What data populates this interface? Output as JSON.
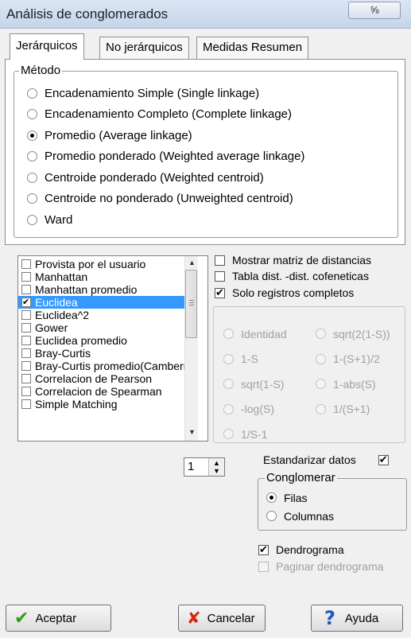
{
  "window": {
    "title": "Análisis de conglomerados",
    "close_glyph": "⅝"
  },
  "tabs": [
    "Jerárquicos",
    "No jerárquicos",
    "Medidas Resumen"
  ],
  "metodo": {
    "legend": "Método",
    "options": [
      "Encadenamiento Simple (Single linkage)",
      "Encadenamiento Completo (Complete linkage)",
      "Promedio (Average linkage)",
      "Promedio ponderado (Weighted average linkage)",
      "Centroide ponderado (Weighted centroid)",
      "Centroide no ponderado (Unweighted centroid)",
      "Ward"
    ],
    "selected_index": 2
  },
  "distance_list": {
    "items": [
      {
        "label": "Provista por el usuario",
        "checked": false
      },
      {
        "label": "Manhattan",
        "checked": false
      },
      {
        "label": "Manhattan promedio",
        "checked": false
      },
      {
        "label": "Euclidea",
        "checked": true
      },
      {
        "label": "Euclidea^2",
        "checked": false
      },
      {
        "label": "Gower",
        "checked": false
      },
      {
        "label": "Euclidea promedio",
        "checked": false
      },
      {
        "label": "Bray-Curtis",
        "checked": false
      },
      {
        "label": "Bray-Curtis promedio(Camberra)",
        "checked": false
      },
      {
        "label": "Correlacion de Pearson",
        "checked": false
      },
      {
        "label": "Correlacion de Spearman",
        "checked": false
      },
      {
        "label": "Simple Matching",
        "checked": false
      }
    ],
    "selected_index": 3,
    "scroll_up": "▲",
    "scroll_down": "▼"
  },
  "options": {
    "mostrar_matriz": {
      "label": "Mostrar matriz de distancias",
      "checked": false
    },
    "tabla_cofeneticas": {
      "label": "Tabla dist. -dist. cofeneticas",
      "checked": false
    },
    "solo_registros": {
      "label": "Solo registros completos",
      "checked": true
    }
  },
  "similarity_transforms": {
    "left": [
      "Identidad",
      "1-S",
      "sqrt(1-S)",
      "-log(S)",
      "1/S-1"
    ],
    "right": [
      "sqrt(2(1-S))",
      "1-(S+1)/2",
      "1-abs(S)",
      "1/(S+1)"
    ]
  },
  "spinner": {
    "value": "1",
    "up": "▲",
    "down": "▼"
  },
  "estandarizar": {
    "label": "Estandarizar datos",
    "checked": true
  },
  "conglomerar": {
    "legend": "Conglomerar",
    "options": [
      "Filas",
      "Columnas"
    ],
    "selected_index": 0
  },
  "dendrograma": {
    "label": "Dendrograma",
    "checked": true
  },
  "paginar": {
    "label": "Paginar dendrograma",
    "checked": false,
    "disabled": true
  },
  "buttons": {
    "aceptar": {
      "label": "Aceptar",
      "icon": "✔",
      "color": "#2f9a1c"
    },
    "cancelar": {
      "label": "Cancelar",
      "icon": "✘",
      "color": "#d42a12"
    },
    "ayuda": {
      "label": "Ayuda",
      "icon": "?",
      "color": "#1f57c8"
    }
  }
}
